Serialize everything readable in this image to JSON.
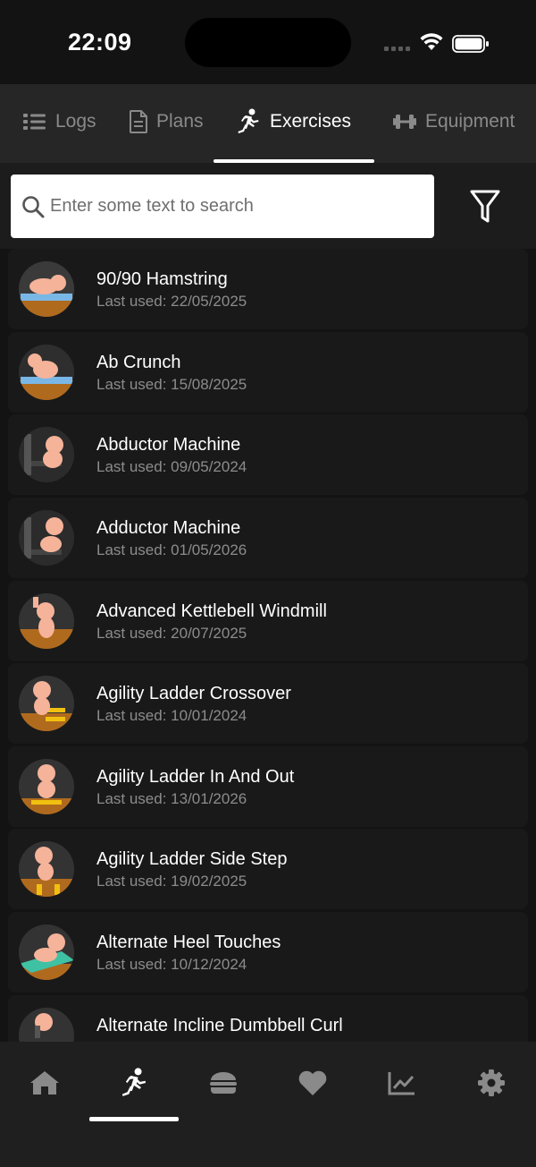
{
  "status": {
    "time": "22:09"
  },
  "tabs": [
    {
      "label": "Logs",
      "icon": "list-icon"
    },
    {
      "label": "Plans",
      "icon": "document-icon"
    },
    {
      "label": "Exercises",
      "icon": "running-icon",
      "active": true
    },
    {
      "label": "Equipment",
      "icon": "dumbbell-icon"
    }
  ],
  "search": {
    "placeholder": "Enter some text to search",
    "value": ""
  },
  "exercises": [
    {
      "name": "90/90 Hamstring",
      "last_used": "Last used: 22/05/2025"
    },
    {
      "name": "Ab Crunch",
      "last_used": "Last used: 15/08/2025"
    },
    {
      "name": "Abductor Machine",
      "last_used": "Last used: 09/05/2024"
    },
    {
      "name": "Adductor Machine",
      "last_used": "Last used: 01/05/2026"
    },
    {
      "name": "Advanced Kettlebell Windmill",
      "last_used": "Last used: 20/07/2025"
    },
    {
      "name": "Agility Ladder Crossover",
      "last_used": "Last used: 10/01/2024"
    },
    {
      "name": "Agility Ladder In And Out",
      "last_used": "Last used: 13/01/2026"
    },
    {
      "name": "Agility Ladder Side Step",
      "last_used": "Last used: 19/02/2025"
    },
    {
      "name": "Alternate Heel Touches",
      "last_used": "Last used: 10/12/2024"
    },
    {
      "name": "Alternate Incline Dumbbell Curl",
      "last_used": ""
    }
  ],
  "bottom_nav": [
    {
      "icon": "home-icon"
    },
    {
      "icon": "running-icon",
      "active": true
    },
    {
      "icon": "burger-icon"
    },
    {
      "icon": "heart-icon"
    },
    {
      "icon": "chart-icon"
    },
    {
      "icon": "gear-icon"
    }
  ],
  "colors": {
    "background": "#131313",
    "tab_bar": "#262626",
    "card": "#191919",
    "active": "#ffffff",
    "inactive": "#8a8a8a"
  }
}
